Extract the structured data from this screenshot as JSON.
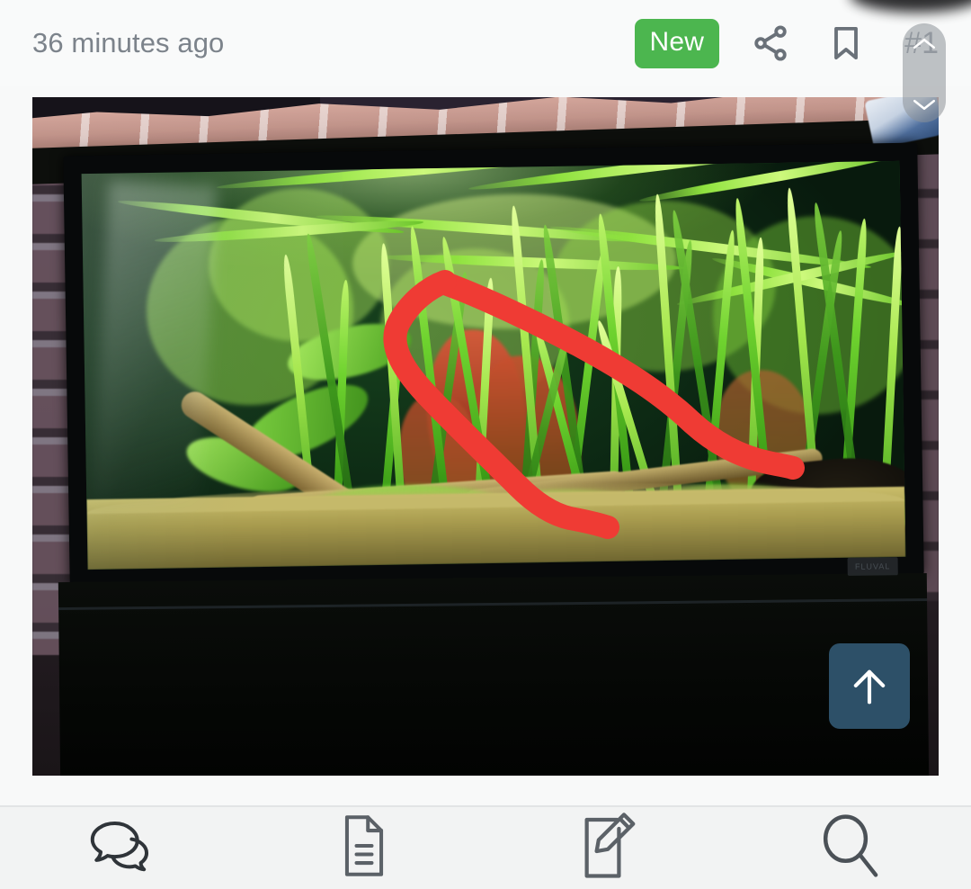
{
  "header": {
    "timestamp": "36 minutes ago",
    "badge_new": "New",
    "post_number": "#1",
    "share_icon": "share-icon",
    "bookmark_icon": "bookmark-icon"
  },
  "scroll_pill": {
    "up_icon": "chevron-up-icon",
    "down_icon": "chevron-down-icon"
  },
  "post": {
    "image_alt": "Planted freshwater aquarium with dense vallisneria grass, driftwood and red stem plants, photographed against a brick wall, with a red hand-drawn annotation line",
    "annotation_color": "#ef3b34",
    "tank_brand_label": "FLUVAL"
  },
  "fab": {
    "icon": "arrow-up-icon",
    "color": "#2d5068"
  },
  "toolbar": {
    "items": [
      {
        "name": "comments",
        "icon": "chat-bubbles-icon"
      },
      {
        "name": "document",
        "icon": "document-icon"
      },
      {
        "name": "compose",
        "icon": "pencil-edit-icon"
      },
      {
        "name": "search",
        "icon": "search-icon"
      }
    ]
  },
  "colors": {
    "badge_green": "#4cb64f",
    "text_gray": "#7c838b",
    "page_bg": "#f8f9f9",
    "toolbar_bg": "#f2f3f3",
    "icon_dark": "#30363c"
  }
}
